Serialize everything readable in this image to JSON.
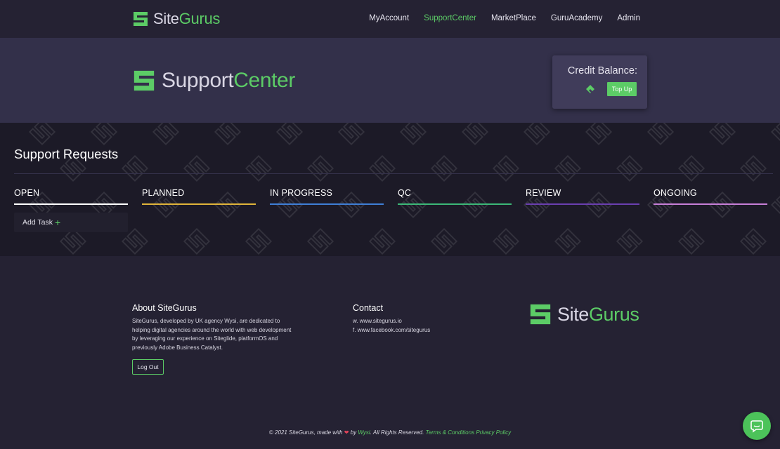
{
  "nav": {
    "brand_left": "Site",
    "brand_right": "Gurus",
    "links": [
      "MyAccount",
      "SupportCenter",
      "MarketPlace",
      "GuruAcademy",
      "Admin"
    ],
    "active": "SupportCenter"
  },
  "hero": {
    "title_left": "Support",
    "title_right": "Center",
    "credit_title": "Credit Balance:",
    "topup_label": "Top Up"
  },
  "board": {
    "title": "Support Requests",
    "columns": [
      {
        "label": "OPEN",
        "color": "#ffffff"
      },
      {
        "label": "PLANNED",
        "color": "#e0b43a"
      },
      {
        "label": "IN PROGRESS",
        "color": "#3f7fd6"
      },
      {
        "label": "QC",
        "color": "#3cb878"
      },
      {
        "label": "REVIEW",
        "color": "#6b3fb0"
      },
      {
        "label": "ONGOING",
        "color": "#c77fd8"
      }
    ],
    "add_task_label": "Add Task",
    "add_task_icon": "+"
  },
  "footer": {
    "about_title": "About SiteGurus",
    "about_text": "SiteGurus, developed by UK agency Wysi, are dedicated to helping digital agencies around the world with web development by leveraging our experience on Siteglide, platformOS and previously Adobe Business Catalyst.",
    "logout_label": "Log Out",
    "contact_title": "Contact",
    "contact_web": "w. www.sitegurus.io",
    "contact_fb": "f. www.facebook.com/sitegurus",
    "brand_left": "Site",
    "brand_right": "Gurus",
    "copy_prefix": "© 2021 SiteGurus, made with",
    "copy_by": "by",
    "copy_wysi": "Wysi",
    "copy_rights": ". All Rights Reserved.",
    "terms": "Terms & Conditions",
    "privacy": "Privacy Policy"
  },
  "colors": {
    "accent": "#5ccc66",
    "bg": "#252233",
    "hero_bg": "#33304a",
    "board_bg": "#1c1a27"
  },
  "icons": {
    "logo": "sitegurus-logo-icon",
    "chat": "chat-bubble-icon",
    "heart": "heart-icon"
  }
}
